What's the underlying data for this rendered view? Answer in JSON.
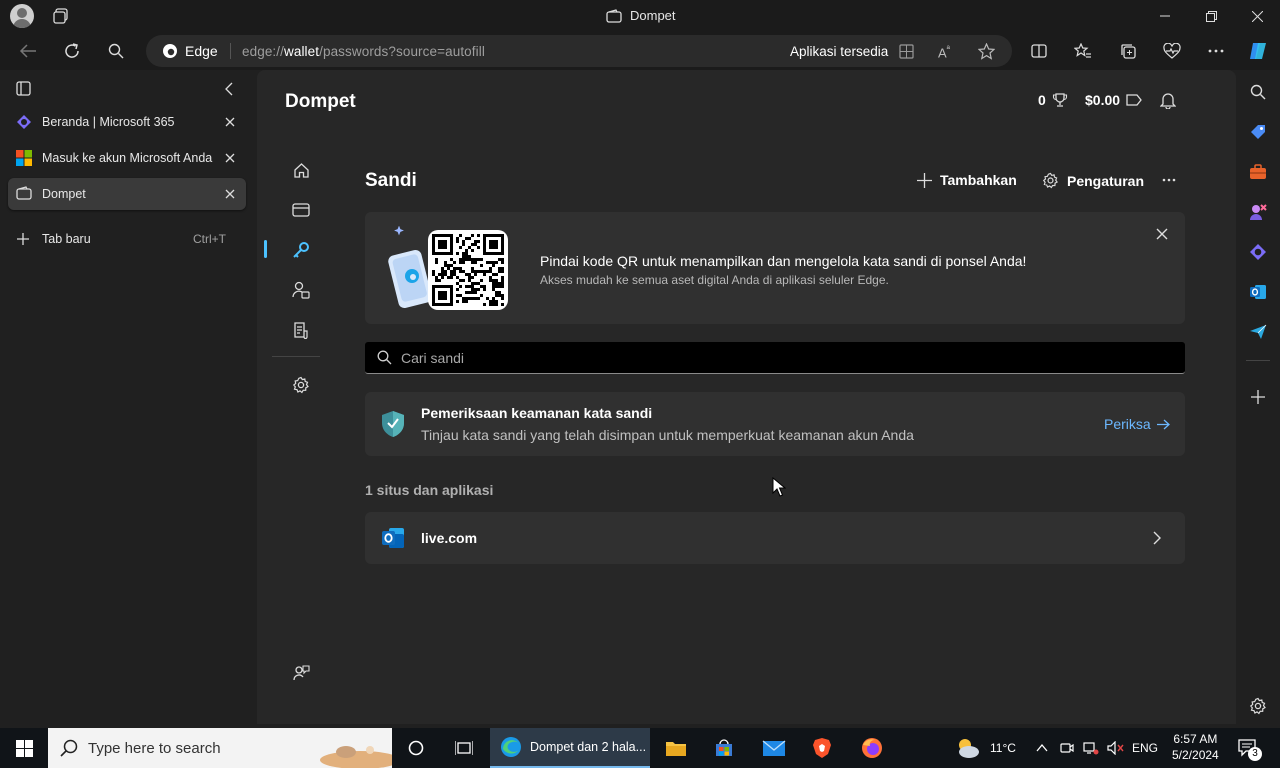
{
  "window": {
    "title": "Dompet"
  },
  "toolbar": {
    "brand": "Edge",
    "url_prefix": "edge://",
    "url_host": "wallet",
    "url_path": "/passwords?source=autofill",
    "apps_label": "Aplikasi tersedia"
  },
  "tabs": [
    {
      "label": "Beranda | Microsoft 365"
    },
    {
      "label": "Masuk ke akun Microsoft Anda"
    },
    {
      "label": "Dompet"
    }
  ],
  "new_tab": {
    "label": "Tab baru",
    "shortcut": "Ctrl+T"
  },
  "wallet": {
    "title": "Dompet",
    "points": "0",
    "cash": "$0.00"
  },
  "passwords": {
    "title": "Sandi",
    "add_label": "Tambahkan",
    "settings_label": "Pengaturan",
    "qr_title": "Pindai kode QR untuk menampilkan dan mengelola kata sandi di ponsel Anda!",
    "qr_subtitle": "Akses mudah ke semua aset digital Anda di aplikasi seluler Edge.",
    "search_placeholder": "Cari sandi",
    "security_title": "Pemeriksaan keamanan kata sandi",
    "security_desc": "Tinjau kata sandi yang telah disimpan untuk memperkuat keamanan akun Anda",
    "check_label": "Periksa",
    "count_label": "1 situs dan aplikasi",
    "sites": [
      {
        "name": "live.com"
      }
    ]
  },
  "taskbar": {
    "search_placeholder": "Type here to search",
    "edge_label": "Dompet dan 2 hala...",
    "weather": "11°C",
    "lang": "ENG",
    "time": "6:57 AM",
    "date": "5/2/2024",
    "notif_count": "3"
  },
  "colors": {
    "accent": "#4cc2ff",
    "link": "#6cb8ff",
    "panel": "#272727",
    "card": "#303030"
  }
}
